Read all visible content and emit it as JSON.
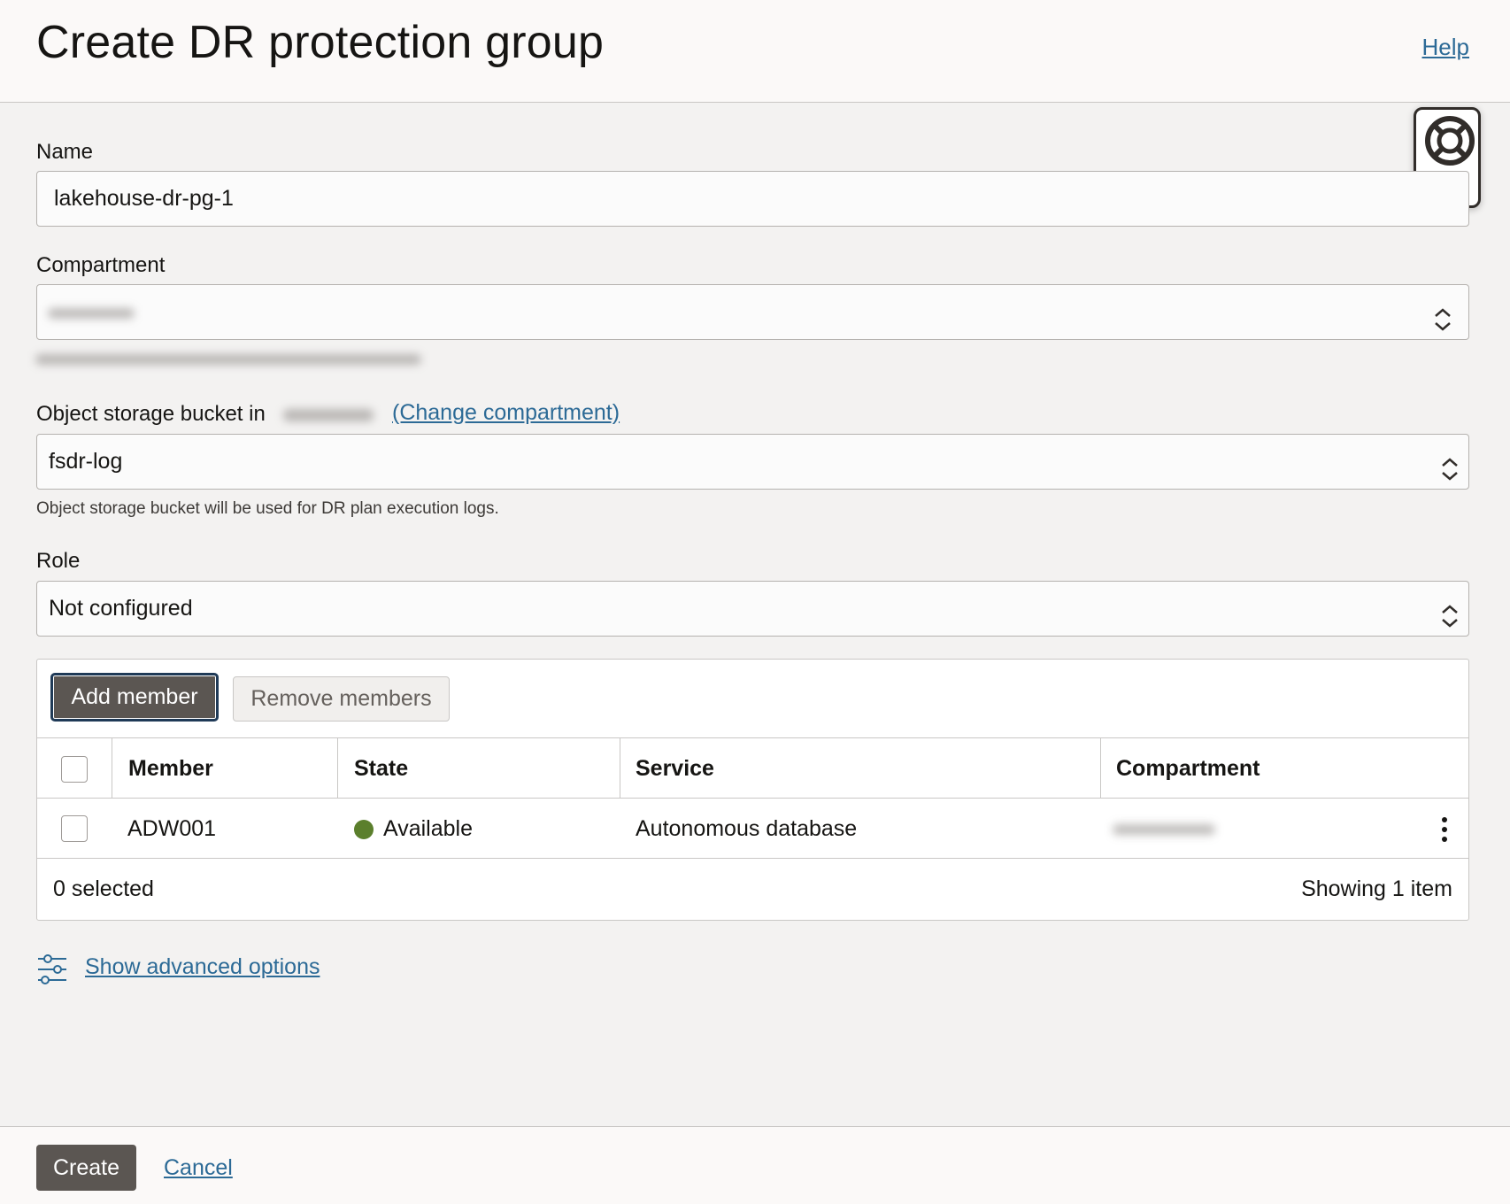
{
  "header": {
    "title": "Create DR protection group",
    "help": "Help"
  },
  "assist_widget": {
    "icons": [
      "lifebuoy-icon",
      "apps-grid-icon"
    ]
  },
  "form": {
    "name_label": "Name",
    "name_value": "lakehouse-dr-pg-1",
    "compartment_label": "Compartment",
    "compartment_value": "",
    "bucket_label": "Object storage bucket in",
    "change_compartment": "(Change compartment)",
    "bucket_value": "fsdr-log",
    "bucket_helper": "Object storage bucket will be used for DR plan execution logs.",
    "role_label": "Role",
    "role_value": "Not configured"
  },
  "members": {
    "add_button": "Add member",
    "remove_button": "Remove members",
    "columns": [
      "Member",
      "State",
      "Service",
      "Compartment"
    ],
    "rows": [
      {
        "member": "ADW001",
        "state": "Available",
        "state_color": "#5b7f2c",
        "service": "Autonomous database",
        "compartment": ""
      }
    ],
    "selected_text": "0 selected",
    "showing_text": "Showing 1 item"
  },
  "advanced": {
    "link": "Show advanced options"
  },
  "footer": {
    "create": "Create",
    "cancel": "Cancel"
  },
  "colors": {
    "link": "#2c6a96",
    "primary_button": "#5b5652",
    "available": "#5b7f2c"
  }
}
